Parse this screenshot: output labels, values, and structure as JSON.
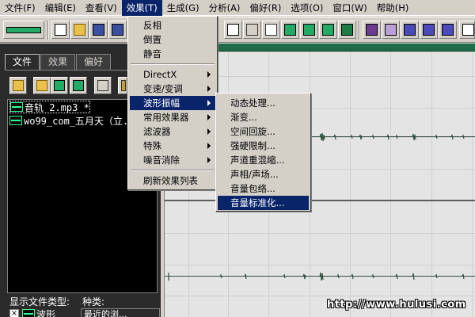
{
  "menubar": {
    "items": [
      {
        "label": "文件(F)"
      },
      {
        "label": "编辑(E)"
      },
      {
        "label": "查看(V)"
      },
      {
        "label": "效果(T)"
      },
      {
        "label": "生成(G)"
      },
      {
        "label": "分析(A)"
      },
      {
        "label": "偏好(R)"
      },
      {
        "label": "选项(O)"
      },
      {
        "label": "窗口(W)"
      },
      {
        "label": "帮助(H)"
      }
    ]
  },
  "effects_menu": {
    "items": [
      {
        "label": "反相"
      },
      {
        "label": "倒置"
      },
      {
        "label": "静音"
      },
      {
        "label": "DirectX"
      },
      {
        "label": "变速/变调"
      },
      {
        "label": "波形振幅"
      },
      {
        "label": "常用效果器"
      },
      {
        "label": "滤波器"
      },
      {
        "label": "特殊"
      },
      {
        "label": "噪音消除"
      },
      {
        "label": "刷新效果列表"
      }
    ],
    "highlighted": "波形振幅"
  },
  "amplitude_submenu": {
    "items": [
      {
        "label": "动态处理..."
      },
      {
        "label": "渐变..."
      },
      {
        "label": "空间回旋..."
      },
      {
        "label": "强硬限制..."
      },
      {
        "label": "声道重混缩..."
      },
      {
        "label": "声相/声场..."
      },
      {
        "label": "音量包络..."
      },
      {
        "label": "音量标准化..."
      }
    ],
    "highlighted": "音量标准化..."
  },
  "left_panel": {
    "tabs": [
      {
        "label": "文件"
      },
      {
        "label": "效果"
      },
      {
        "label": "偏好"
      }
    ],
    "files": [
      {
        "label": "音轨  2.mp3 *"
      },
      {
        "label": "wo99_com_五月天（立..."
      }
    ],
    "filetype_label": "显示文件类型:",
    "kind_label": "种类:",
    "wave_check_label": "波形",
    "kind_select_value": "最近的浏..."
  },
  "watermark": "http://www.hulusi.com",
  "colors": {
    "menu_highlight": "#0a246a",
    "panel_bg": "#2b2b2b",
    "ruler": "#1e6b4a",
    "wave_bg": "#e4e4e4"
  }
}
